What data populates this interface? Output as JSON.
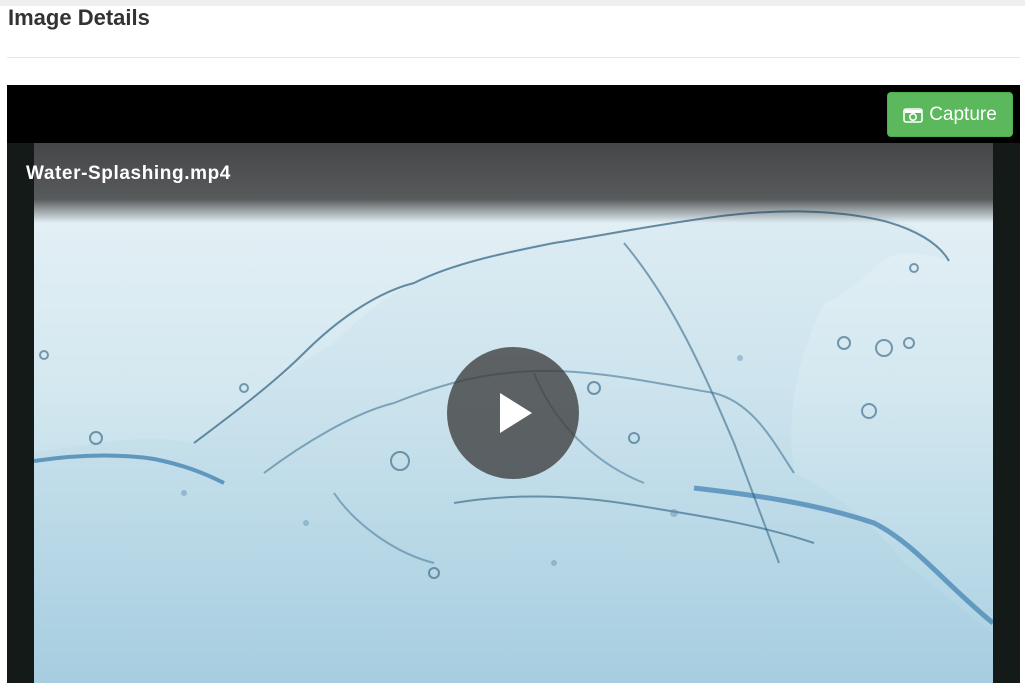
{
  "page": {
    "title": "Image Details"
  },
  "player": {
    "video_title": "Water-Splashing.mp4",
    "capture_label": "Capture",
    "icons": {
      "capture": "camera-icon",
      "play": "play-icon"
    },
    "colors": {
      "capture_button": "#5cb85c",
      "player_background": "#000000"
    }
  }
}
